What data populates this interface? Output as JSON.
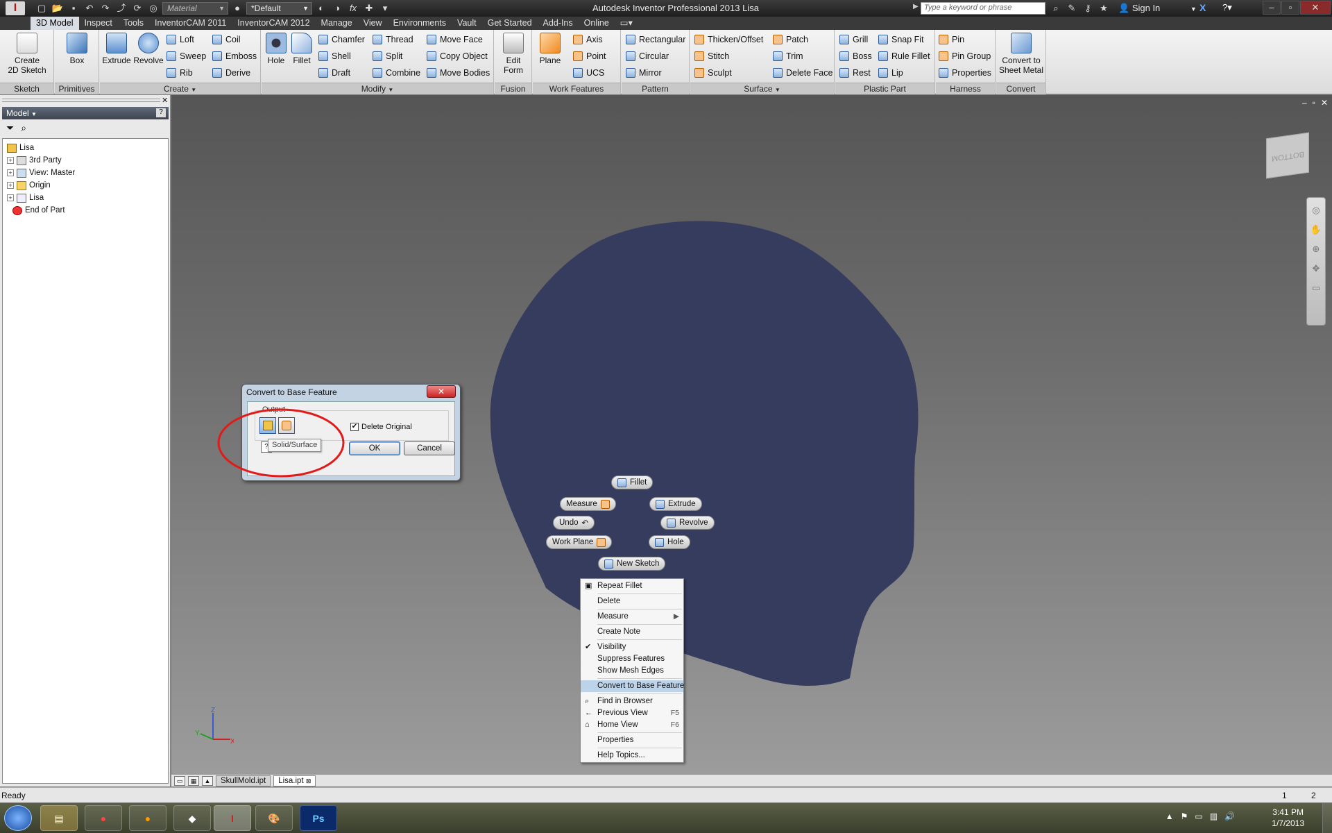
{
  "colors": {
    "accent": "#2a5a9a",
    "dialog_title": "#c4d3e3",
    "menu_highlight": "#bcd3ea",
    "part_color": "#353c5e",
    "annotation_circle": "#e11a1a"
  },
  "titlebar": {
    "title": "Autodesk Inventor Professional 2013   Lisa",
    "material": "Material",
    "appearance": "*Default",
    "search_placeholder": "Type a keyword or phrase",
    "sign_in": "Sign In",
    "fx": "fx"
  },
  "tabs": [
    "3D Model",
    "Inspect",
    "Tools",
    "InventorCAM 2011",
    "InventorCAM 2012",
    "Manage",
    "View",
    "Environments",
    "Vault",
    "Get Started",
    "Add-Ins",
    "Online"
  ],
  "ribbon": {
    "sketch": {
      "label": "Sketch",
      "create_2d": [
        "Create",
        "2D Sketch"
      ]
    },
    "primitives": {
      "label": "Primitives",
      "box": "Box"
    },
    "create": {
      "label": "Create",
      "extrude": "Extrude",
      "revolve": "Revolve",
      "loft": "Loft",
      "sweep": "Sweep",
      "rib": "Rib",
      "coil": "Coil",
      "emboss": "Emboss",
      "derive": "Derive"
    },
    "modify": {
      "label": "Modify",
      "hole": "Hole",
      "fillet": "Fillet",
      "chamfer": "Chamfer",
      "shell": "Shell",
      "draft": "Draft",
      "thread": "Thread",
      "split": "Split",
      "combine": "Combine",
      "move_face": "Move Face",
      "copy_object": "Copy Object",
      "move_bodies": "Move Bodies"
    },
    "fusion": {
      "label": "Fusion",
      "edit_form": [
        "Edit",
        "Form"
      ]
    },
    "work_features": {
      "label": "Work Features",
      "plane": "Plane",
      "axis": "Axis",
      "point": "Point",
      "ucs": "UCS"
    },
    "pattern": {
      "label": "Pattern",
      "rectangular": "Rectangular",
      "circular": "Circular",
      "mirror": "Mirror"
    },
    "surface": {
      "label": "Surface",
      "thicken": "Thicken/Offset",
      "stitch": "Stitch",
      "sculpt": "Sculpt",
      "patch": "Patch",
      "trim": "Trim",
      "delete_face": "Delete Face"
    },
    "plastic_part": {
      "label": "Plastic Part",
      "grill": "Grill",
      "boss": "Boss",
      "rest": "Rest",
      "snap_fit": "Snap Fit",
      "rule_fillet": "Rule Fillet",
      "lip": "Lip"
    },
    "harness": {
      "label": "Harness",
      "pin": "Pin",
      "pin_group": "Pin Group",
      "properties": "Properties"
    },
    "convert": {
      "label": "Convert",
      "convert_sheet": [
        "Convert to",
        "Sheet Metal"
      ]
    }
  },
  "browser": {
    "title": "Model",
    "tree": [
      {
        "label": "Lisa",
        "expander": false
      },
      {
        "label": "3rd Party",
        "expander": true
      },
      {
        "label": "View: Master",
        "expander": true
      },
      {
        "label": "Origin",
        "expander": true
      },
      {
        "label": "Lisa",
        "expander": true
      },
      {
        "label": "End of Part",
        "expander": false
      }
    ]
  },
  "viewport": {
    "viewcube_label": "BOTTOM",
    "triad": {
      "x": "X",
      "y": "Y",
      "z": "Z"
    },
    "mini_toolbar": {
      "fillet": "Fillet",
      "measure": "Measure",
      "extrude": "Extrude",
      "undo": "Undo",
      "revolve": "Revolve",
      "work_plane": "Work Plane",
      "hole": "Hole",
      "new_sketch": "New Sketch"
    }
  },
  "context_menu": [
    {
      "label": "Repeat Fillet",
      "icon": true
    },
    {
      "label": "Delete"
    },
    {
      "label": "Measure",
      "submenu": true
    },
    {
      "label": "Create Note"
    },
    {
      "label": "Visibility",
      "check": true
    },
    {
      "label": "Suppress Features"
    },
    {
      "label": "Show Mesh Edges"
    },
    {
      "label": "Convert to Base Feature",
      "selected": true
    },
    {
      "label": "Find in Browser",
      "icon": true
    },
    {
      "label": "Previous View",
      "shortcut": "F5",
      "icon": true
    },
    {
      "label": "Home View",
      "shortcut": "F6",
      "icon": true
    },
    {
      "label": "Properties"
    },
    {
      "label": "Help Topics..."
    }
  ],
  "dialog": {
    "title": "Convert to Base Feature",
    "group": "Output",
    "delete_original": "Delete Original",
    "tooltip": "Solid/Surface",
    "ok": "OK",
    "cancel": "Cancel"
  },
  "doc_tabs": [
    "SkullMold.ipt",
    "Lisa.ipt"
  ],
  "status": {
    "text": "Ready",
    "n1": "1",
    "n2": "2"
  },
  "clock": {
    "time": "3:41 PM",
    "date": "1/7/2013"
  },
  "taskbar": {
    "photoshop": "Ps"
  }
}
